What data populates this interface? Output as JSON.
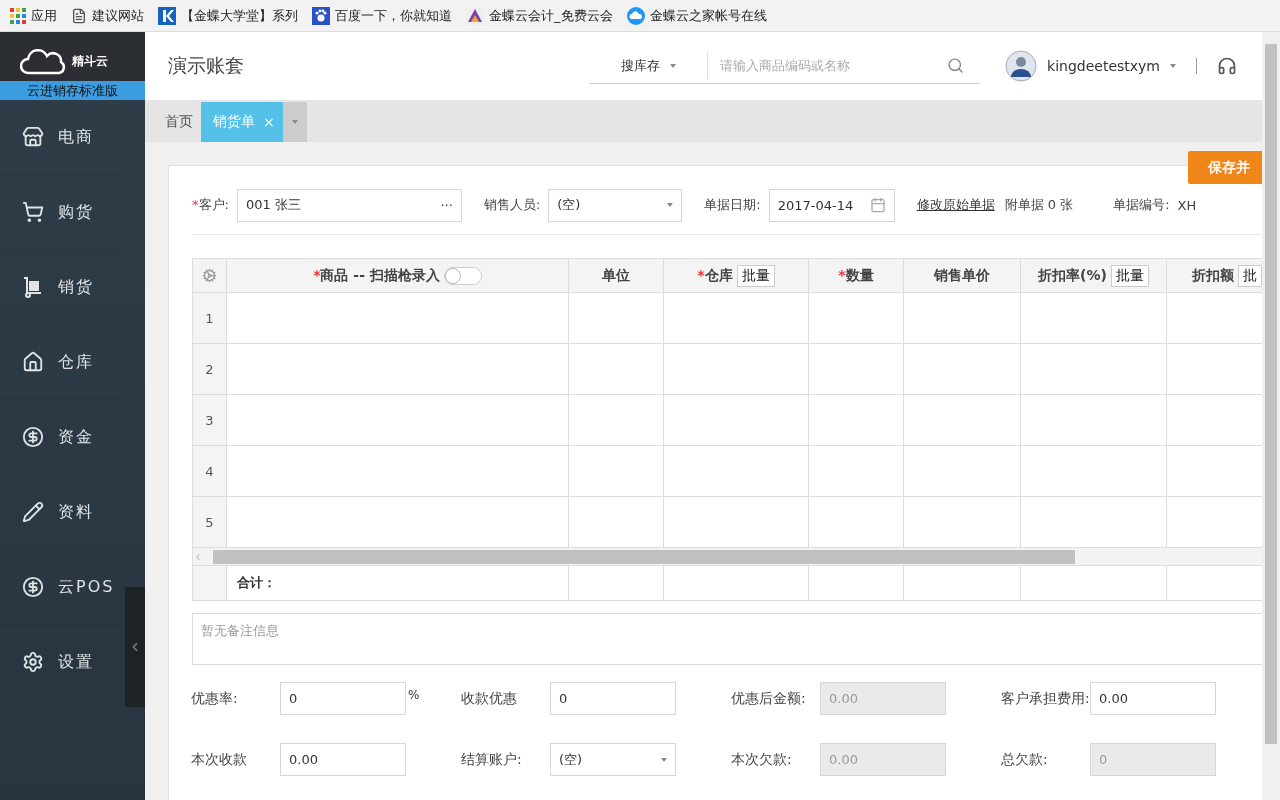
{
  "bookmarks": [
    {
      "kind": "apps",
      "label": "应用"
    },
    {
      "kind": "page",
      "label": "建议网站"
    },
    {
      "kind": "k",
      "label": "【金蝶大学堂】系列"
    },
    {
      "kind": "paw",
      "label": "百度一下，你就知道"
    },
    {
      "kind": "triangle",
      "label": "金蝶云会计_免费云会"
    },
    {
      "kind": "cloud",
      "label": "金蝶云之家帐号在线"
    }
  ],
  "sidebar": {
    "brand": "精斗云",
    "edition": "云进销存标准版",
    "items": [
      {
        "kind": "store",
        "label": "电商"
      },
      {
        "kind": "cart",
        "label": "购货"
      },
      {
        "kind": "dolly",
        "label": "销货"
      },
      {
        "kind": "house",
        "label": "仓库"
      },
      {
        "kind": "dollar",
        "label": "资金"
      },
      {
        "kind": "pencil",
        "label": "资料"
      },
      {
        "kind": "dollar",
        "label": "云POS"
      },
      {
        "kind": "gear",
        "label": "设置"
      }
    ]
  },
  "header": {
    "title": "演示账套",
    "search": {
      "scope": "搜库存",
      "placeholder": "请输入商品编码或名称"
    },
    "user": "kingdeetestxym"
  },
  "tabs": [
    {
      "label": "首页",
      "selected": false
    },
    {
      "label": "销货单",
      "selected": true,
      "close": "×"
    }
  ],
  "save_button": "保存并",
  "form": {
    "customer": {
      "label": "客户:",
      "mark": "*",
      "value": "001 张三",
      "more": "···"
    },
    "salesperson": {
      "label": "销售人员:",
      "value": "(空)"
    },
    "date": {
      "label": "单据日期:",
      "value": "2017-04-14"
    },
    "edit_link": "修改原始单据",
    "attachments": "附单据 0 张",
    "bill_no": {
      "label": "单据编号:",
      "value": "XH"
    }
  },
  "table": {
    "columns": [
      {
        "label": "商品 -- 扫描枪录入",
        "mark": "*",
        "scanner": {
          "on": false
        }
      },
      {
        "label": "单位"
      },
      {
        "label": "仓库",
        "mark": "*",
        "batch": "批量"
      },
      {
        "label": "数量",
        "mark": "*"
      },
      {
        "label": "销售单价"
      },
      {
        "label": "折扣率(%)",
        "batch": "批量"
      },
      {
        "label": "折扣额",
        "batch": "批"
      }
    ],
    "rows": [
      "1",
      "2",
      "3",
      "4",
      "5"
    ],
    "total_label": "合计："
  },
  "remark": {
    "placeholder": "暂无备注信息"
  },
  "summary": [
    [
      {
        "label": "优惠率:",
        "kind": "input",
        "value": "0",
        "suffix": "%"
      },
      {
        "label": "收款优惠",
        "kind": "input",
        "value": "0"
      },
      {
        "label": "优惠后金额:",
        "kind": "disabled",
        "value": "0.00"
      },
      {
        "label": "客户承担费用:",
        "kind": "input",
        "value": "0.00"
      }
    ],
    [
      {
        "label": "本次收款",
        "kind": "input",
        "value": "0.00"
      },
      {
        "label": "结算账户:",
        "kind": "select",
        "value": "(空)"
      },
      {
        "label": "本次欠款:",
        "kind": "disabled",
        "value": "0.00"
      },
      {
        "label": "总欠款:",
        "kind": "disabled",
        "value": "0"
      }
    ]
  ]
}
